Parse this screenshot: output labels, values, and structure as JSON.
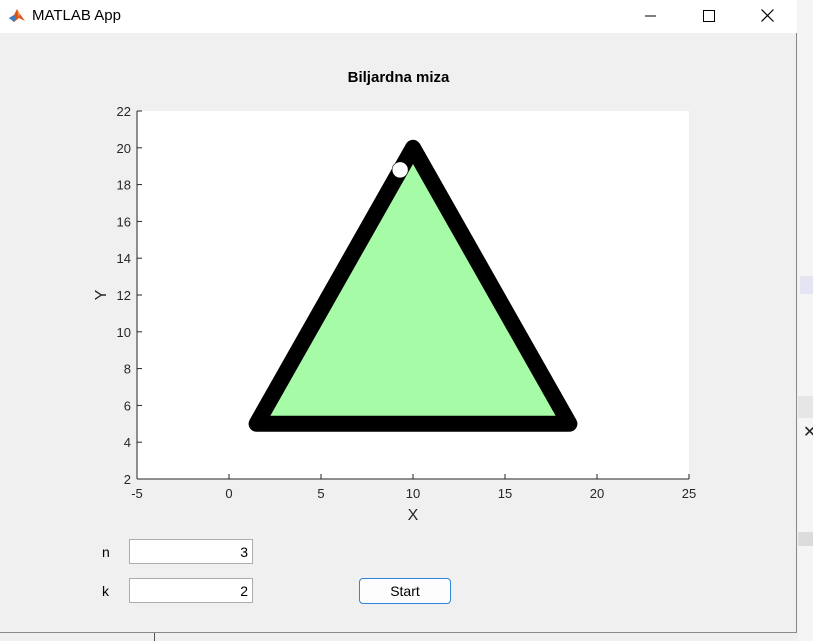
{
  "window": {
    "title": "MATLAB App",
    "controls": [
      "minimize-icon",
      "maximize-icon",
      "close-icon"
    ]
  },
  "axes": {
    "title": "Biljardna miza",
    "xlabel": "X",
    "ylabel": "Y",
    "xlim": [
      -5,
      25
    ],
    "ylim": [
      2,
      22
    ],
    "xticks": [
      "-5",
      "0",
      "5",
      "10",
      "15",
      "20",
      "25"
    ],
    "yticks": [
      "2",
      "4",
      "6",
      "8",
      "10",
      "12",
      "14",
      "16",
      "18",
      "20",
      "22"
    ]
  },
  "chart_data": {
    "type": "scatter",
    "title": "Biljardna miza",
    "xlabel": "X",
    "ylabel": "Y",
    "xlim": [
      -5,
      25
    ],
    "ylim": [
      2,
      22
    ],
    "table": {
      "shape": "triangle",
      "vertices": [
        [
          1.5,
          5
        ],
        [
          10,
          20
        ],
        [
          18.5,
          5
        ]
      ],
      "fill_color": "#a6fca6",
      "edge_color": "#000000"
    },
    "ball": {
      "x": 9.3,
      "y": 18.8,
      "color": "#ffffff"
    }
  },
  "controls": {
    "n": {
      "label": "n",
      "value": "3"
    },
    "k": {
      "label": "k",
      "value": "2"
    },
    "start_label": "Start"
  },
  "colors": {
    "accent": "#2d86d6",
    "table_fill": "#a6fca6",
    "background": "#f0f0f0"
  }
}
